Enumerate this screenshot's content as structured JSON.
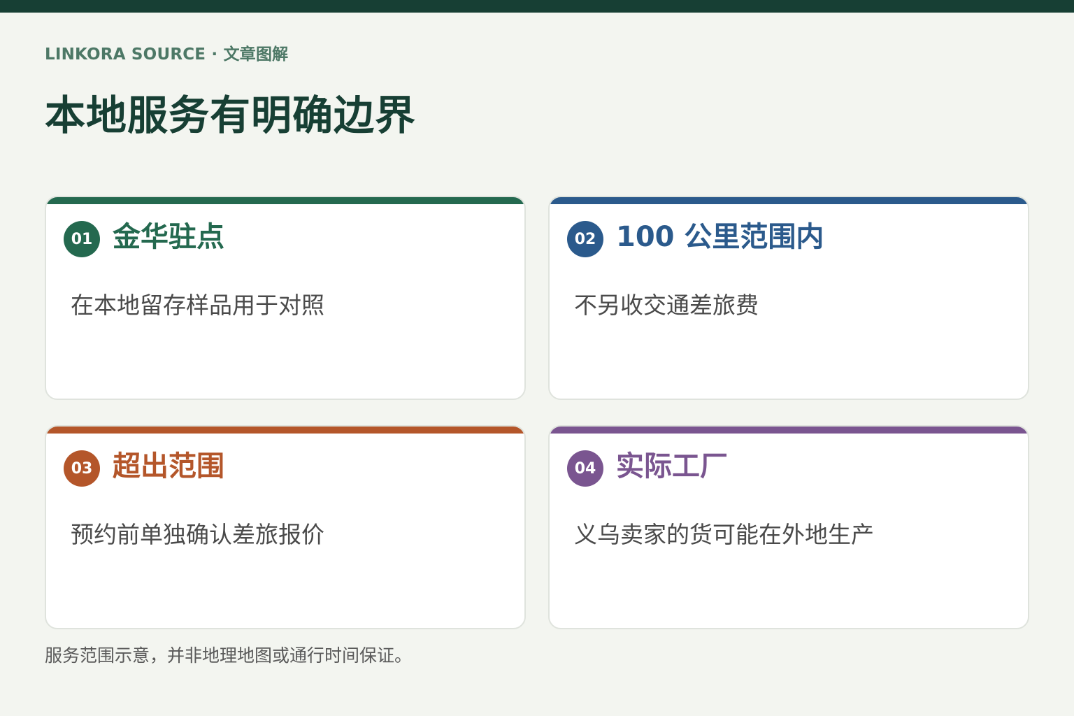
{
  "header": {
    "kicker": "LINKORA SOURCE · 文章图解",
    "title": "本地服务有明确边界"
  },
  "cards": [
    {
      "number": "01",
      "title": "金华驻点",
      "description": "在本地留存样品用于对照",
      "color": "#24694f"
    },
    {
      "number": "02",
      "title": "100 公里范围内",
      "description": "不另收交通差旅费",
      "color": "#2b5a8c"
    },
    {
      "number": "03",
      "title": "超出范围",
      "description": "预约前单独确认差旅报价",
      "color": "#b4562a"
    },
    {
      "number": "04",
      "title": "实际工厂",
      "description": "义乌卖家的货可能在外地生产",
      "color": "#7a5590"
    }
  ],
  "footnote": "服务范围示意，并非地理地图或通行时间保证。",
  "colors": {
    "background": "#f3f5f0",
    "top_bar": "#173f34",
    "title": "#173f34",
    "kicker": "#4d7866"
  }
}
